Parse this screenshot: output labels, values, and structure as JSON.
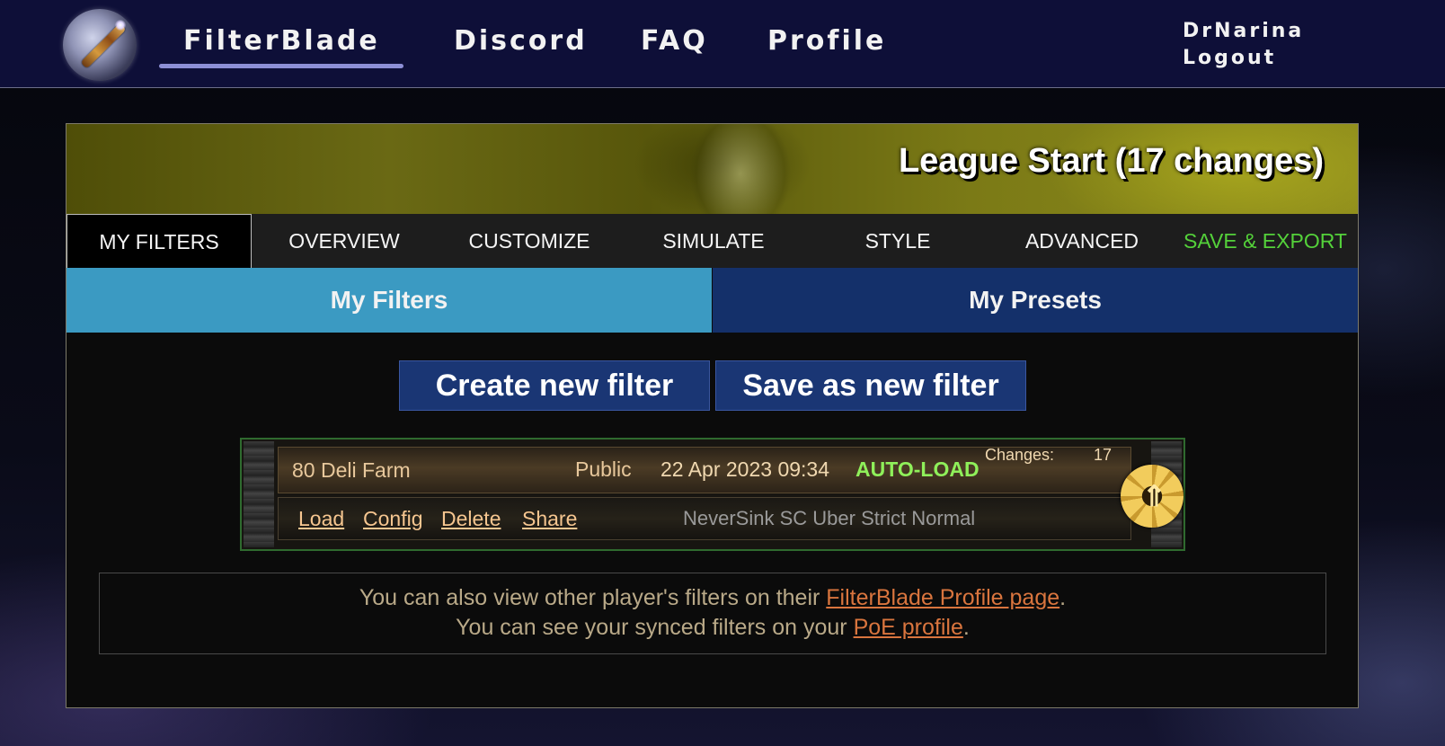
{
  "nav": {
    "brand": "FilterBlade",
    "items": [
      {
        "label": "Discord"
      },
      {
        "label": "FAQ"
      },
      {
        "label": "Profile"
      }
    ],
    "user": {
      "name": "DrNarina",
      "logout": "Logout"
    }
  },
  "banner": {
    "title": "League Start (17 changes)"
  },
  "tabs": [
    {
      "label": "MY FILTERS"
    },
    {
      "label": "OVERVIEW"
    },
    {
      "label": "CUSTOMIZE"
    },
    {
      "label": "SIMULATE"
    },
    {
      "label": "STYLE"
    },
    {
      "label": "ADVANCED"
    },
    {
      "label": "SAVE & EXPORT"
    }
  ],
  "subtabs": {
    "my_filters": "My Filters",
    "my_presets": "My Presets"
  },
  "actions": {
    "create": "Create new filter",
    "save": "Save as new filter"
  },
  "filter": {
    "name": "80 Deli Farm",
    "visibility": "Public",
    "date": "22 Apr 2023 09:34",
    "autoload": "AUTO-LOAD",
    "changes_label": "Changes:",
    "changes_value": "17",
    "base": "NeverSink SC Uber Strict Normal",
    "links": {
      "load": "Load",
      "config": "Config",
      "delete": "Delete",
      "share": "Share"
    }
  },
  "info": {
    "line1_prefix": "You can also view other player's filters on their ",
    "line1_link": "FilterBlade Profile page",
    "line1_suffix": ".",
    "line2_prefix": "You can see your synced filters on your ",
    "line2_link": "PoE profile",
    "line2_suffix": "."
  },
  "colors": {
    "nav_bg": "#0e0f38",
    "active_subtab": "#3b9ac2",
    "inactive_subtab": "#14306a",
    "export_tab": "#54d13a",
    "autoload": "#8ff05a",
    "info_link": "#d9753e"
  }
}
